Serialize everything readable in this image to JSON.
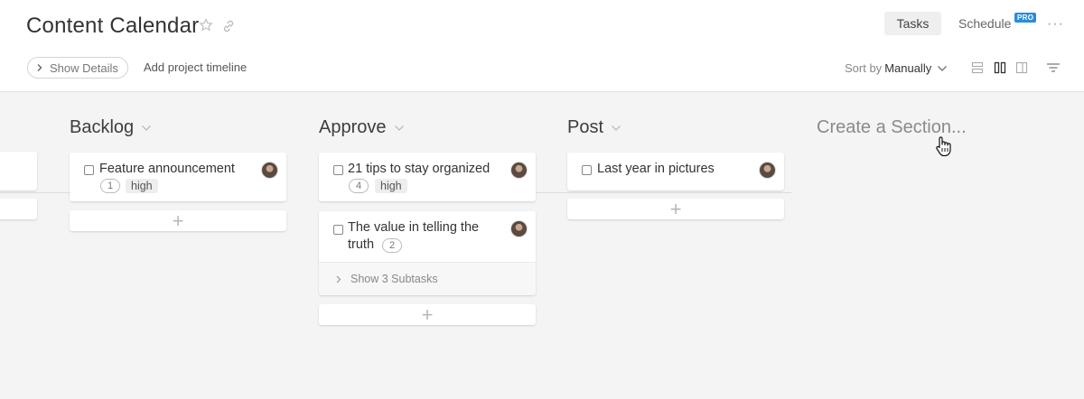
{
  "header": {
    "title": "Content Calendar",
    "tabs": {
      "tasks": "Tasks",
      "schedule": "Schedule",
      "pro_badge": "PRO"
    },
    "more": "···",
    "show_details": "Show Details",
    "add_timeline": "Add project timeline",
    "sort_label": "Sort by",
    "sort_value": "Manually"
  },
  "columns": [
    {
      "title": "Backlog"
    },
    {
      "title": "Approve"
    },
    {
      "title": "Post"
    }
  ],
  "create_section": "Create a Section...",
  "cards": {
    "backlog_1": {
      "title": "Feature announcement",
      "comments": "1",
      "tag": "high"
    },
    "approve_1": {
      "title": "21 tips to stay organized",
      "comments": "4",
      "tag": "high"
    },
    "approve_2": {
      "title_line1": "The value in telling the",
      "title_line2": "truth",
      "comments": "2",
      "subtasks": "Show 3 Subtasks"
    },
    "post_1": {
      "title": "Last year in pictures"
    }
  },
  "add_card": "+",
  "colors": {
    "accent": "#2a8ce0",
    "board_bg": "#f4f4f4"
  },
  "icons": [
    "star-icon",
    "link-icon",
    "chevron-right-icon",
    "chevron-down-icon",
    "list-view-icon",
    "board-view-icon",
    "split-view-icon",
    "filter-icon",
    "cursor-hand-icon"
  ]
}
